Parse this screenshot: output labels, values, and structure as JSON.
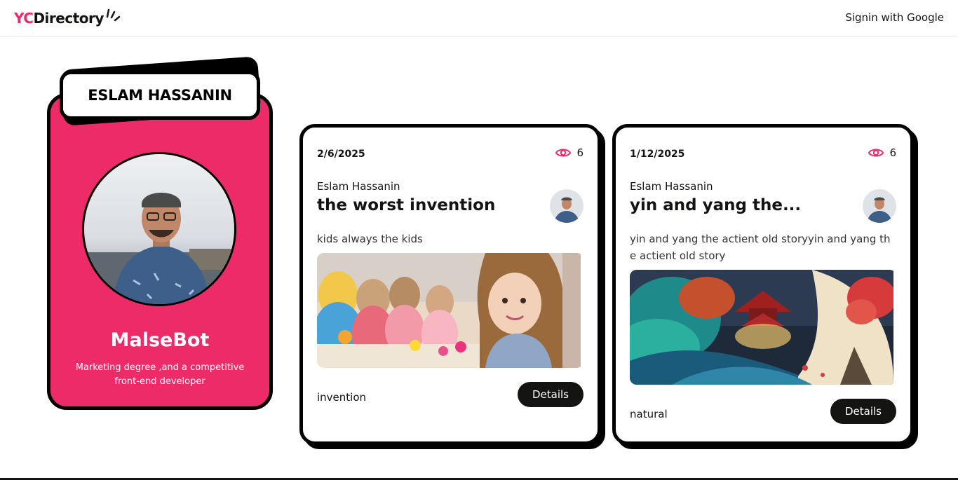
{
  "navbar": {
    "logo_yc": "YC",
    "logo_rest": "Directory",
    "signin_label": "Signin with Google"
  },
  "profile": {
    "name": "Eslam Hassanin",
    "username": "MalseBot",
    "bio": "Marketing degree ,and a competitive front-end developer"
  },
  "startups": [
    {
      "date": "2/6/2025",
      "views": "6",
      "author": "Eslam Hassanin",
      "title": "the worst invention",
      "description": "kids always the kids",
      "category": "invention",
      "details_label": "Details",
      "image": "children-playing-image"
    },
    {
      "date": "1/12/2025",
      "views": "6",
      "author": "Eslam Hassanin",
      "title": "yin and yang the...",
      "description": "yin and yang the actient old storyyin and yang the actient old story",
      "category": "natural",
      "details_label": "Details",
      "image": "yin-yang-landscape-image"
    }
  ],
  "colors": {
    "primary": "#ee2b69",
    "black": "#141413",
    "white": "#ffffff"
  }
}
